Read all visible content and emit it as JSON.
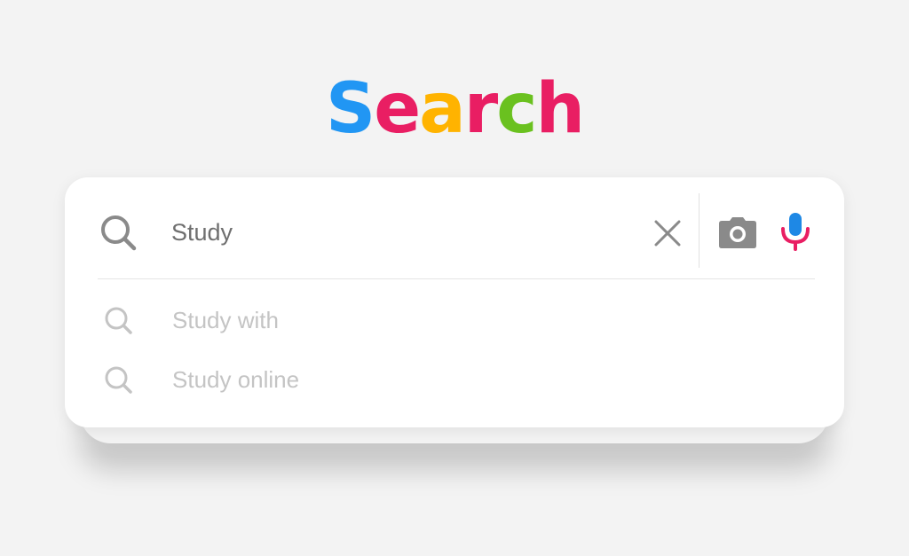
{
  "logo": {
    "letters": [
      "S",
      "e",
      "a",
      "r",
      "c",
      "h"
    ],
    "colors": [
      "#2196f3",
      "#e91e63",
      "#ffb300",
      "#e91e63",
      "#6ac11f",
      "#e91e63"
    ]
  },
  "search_box": {
    "query": "Study",
    "icons": {
      "search": "search-icon",
      "clear": "close-icon",
      "camera": "camera-icon",
      "microphone": "microphone-icon"
    },
    "mic_colors": {
      "top": "#1e88e5",
      "bottom": "#e91e63"
    }
  },
  "suggestions": [
    {
      "label": "Study with",
      "icon": "search-icon"
    },
    {
      "label": "Study online",
      "icon": "search-icon"
    }
  ]
}
